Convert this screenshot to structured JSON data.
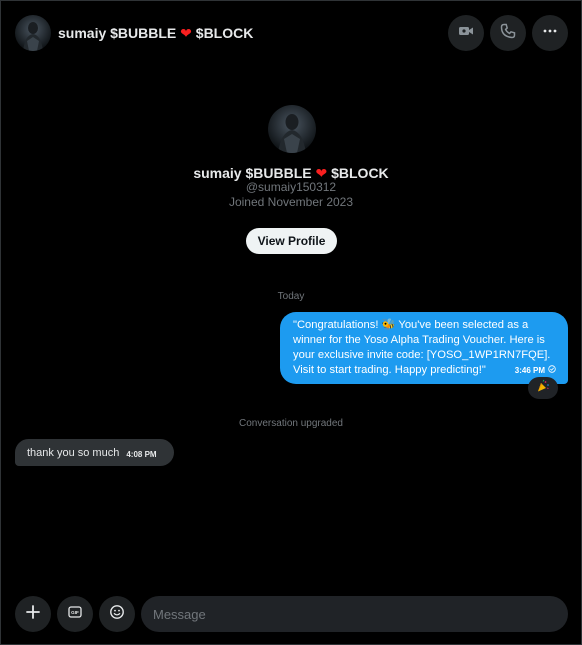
{
  "header": {
    "name": "sumaiy $BUBBLE",
    "name_suffix": "$BLOCK",
    "heart": "❤",
    "buttons": [
      "video-call-icon",
      "phone-icon",
      "more-icon"
    ]
  },
  "profile": {
    "name": "sumaiy $BUBBLE",
    "name_suffix": "$BLOCK",
    "heart": "❤",
    "handle": "@sumaiy150312",
    "joined": "Joined November 2023",
    "view_profile_label": "View Profile"
  },
  "conversation": {
    "day_label": "Today",
    "messages": [
      {
        "direction": "sent",
        "text": "\"Congratulations! 🐝 You've been selected as a winner for the Yoso Alpha Trading Voucher. Here is your exclusive invite code: [YOSO_1WP1RN7FQE]. Visit  to start trading. Happy predicting!\"",
        "time": "3:46 PM",
        "reaction": "🎉"
      },
      {
        "direction": "system",
        "text": "Conversation upgraded"
      },
      {
        "direction": "received",
        "text": "thank you so much",
        "time": "4:08 PM"
      }
    ]
  },
  "composer": {
    "placeholder": "Message",
    "buttons": [
      "add-icon",
      "gif-icon",
      "emoji-icon"
    ]
  },
  "colors": {
    "background": "#000000",
    "sent_bubble": "#1d9bf0",
    "received_bubble": "#2f3336",
    "muted_text": "#71767b",
    "heart": "#f91f1f"
  }
}
